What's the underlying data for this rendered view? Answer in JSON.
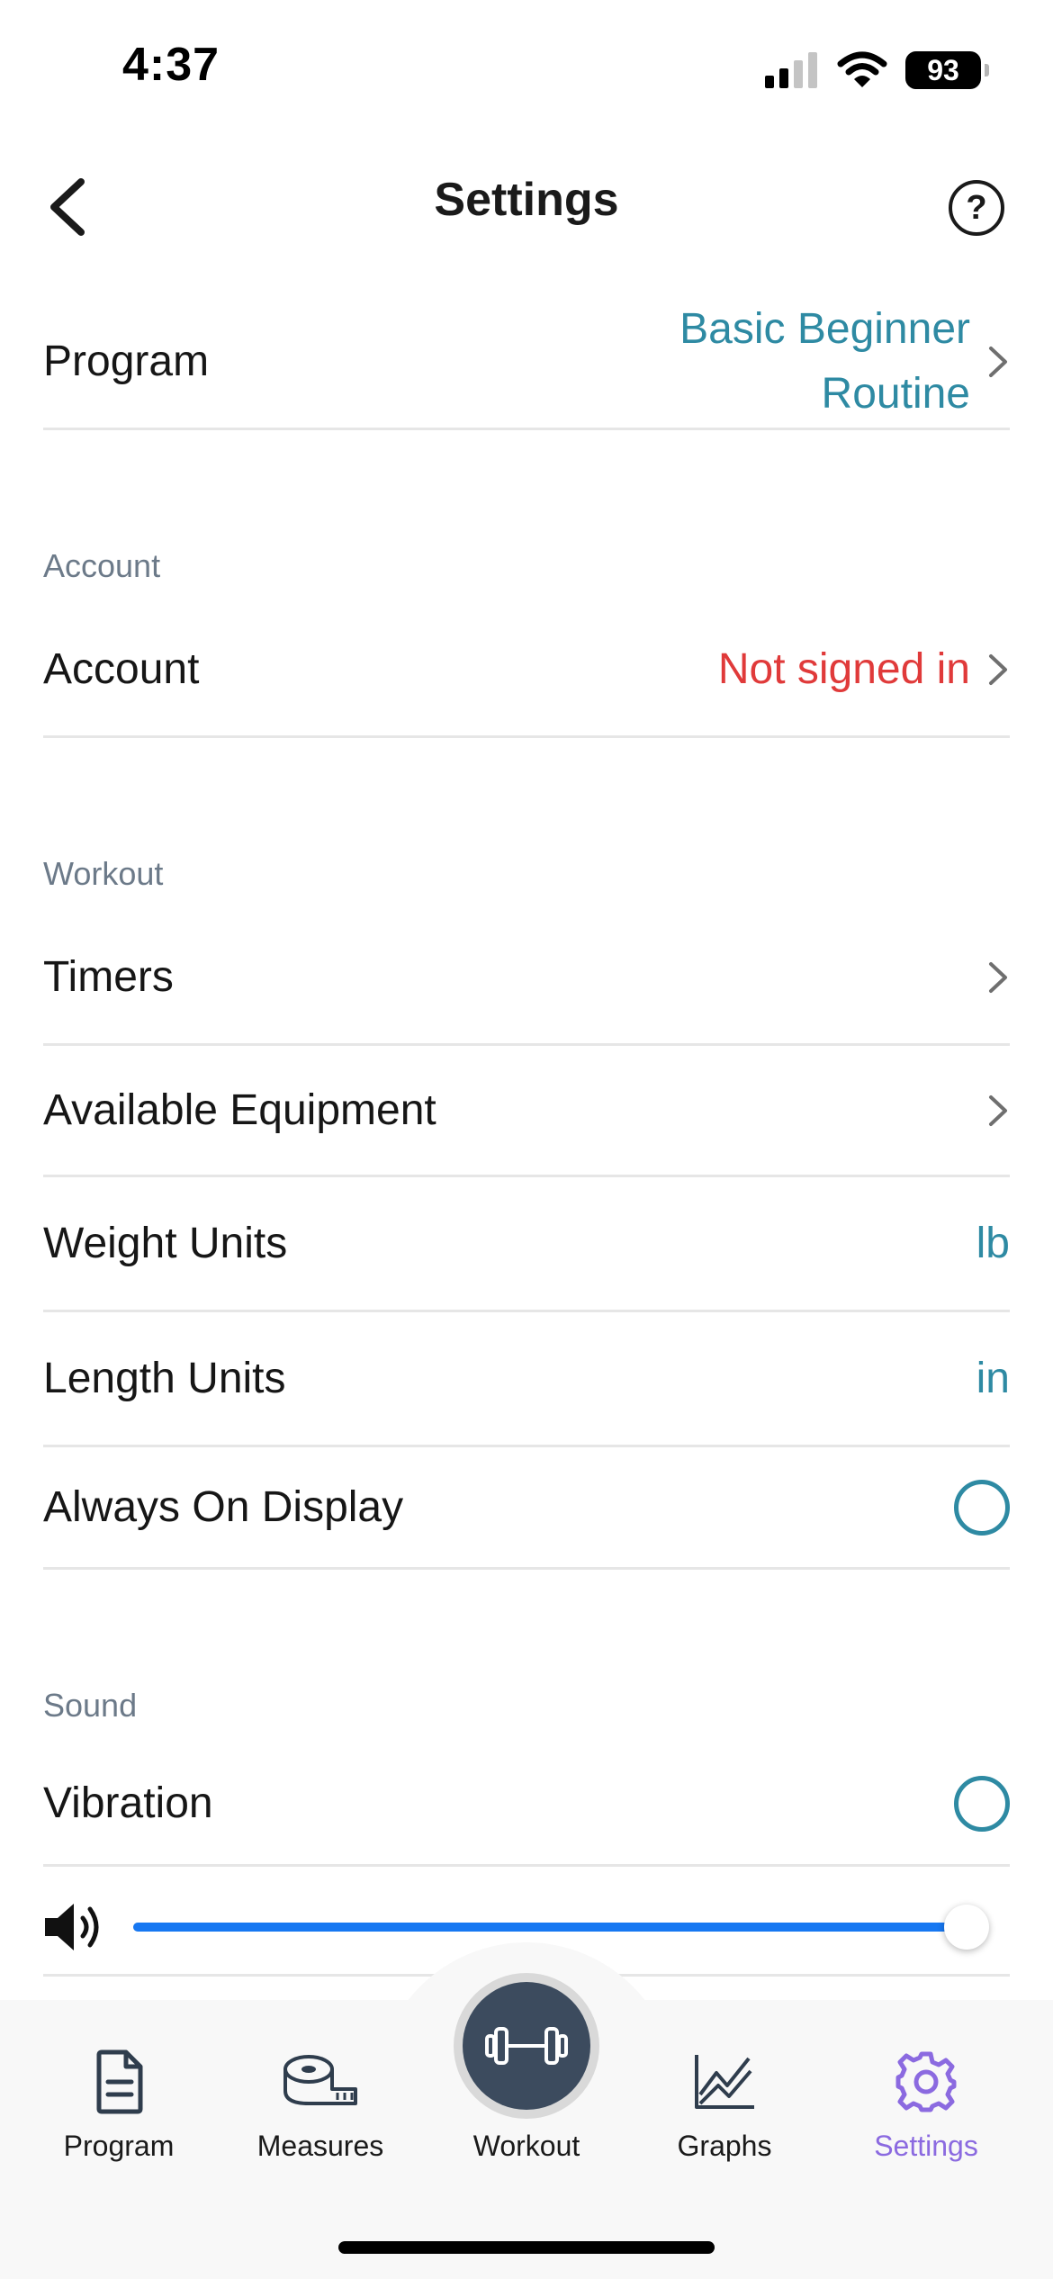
{
  "status_bar": {
    "time": "4:37",
    "battery": "93"
  },
  "nav": {
    "title": "Settings"
  },
  "program_row": {
    "label": "Program",
    "value": "Basic Beginner Routine"
  },
  "sections": {
    "account": "Account",
    "workout": "Workout",
    "sound": "Sound"
  },
  "account_row": {
    "label": "Account",
    "value": "Not signed in"
  },
  "workout_rows": {
    "timers": "Timers",
    "equipment": "Available Equipment",
    "weight": {
      "label": "Weight Units",
      "value": "lb"
    },
    "length": {
      "label": "Length Units",
      "value": "in"
    },
    "display": {
      "label": "Always On Display",
      "checked": false
    }
  },
  "sound_rows": {
    "vibration": {
      "label": "Vibration",
      "checked": false
    },
    "volume": 1.0
  },
  "tabs": [
    {
      "label": "Program",
      "icon": "document-icon"
    },
    {
      "label": "Measures",
      "icon": "tape-measure-icon"
    },
    {
      "label": "Workout",
      "icon": "dumbbell-icon"
    },
    {
      "label": "Graphs",
      "icon": "line-chart-icon"
    },
    {
      "label": "Settings",
      "icon": "gear-icon",
      "active": true
    }
  ],
  "colors": {
    "accent": "#2e8aa3",
    "error": "#e03a3a",
    "active_tab": "#8b6ae0",
    "slider": "#1778f2",
    "workout_button": "#3c4b5e"
  }
}
